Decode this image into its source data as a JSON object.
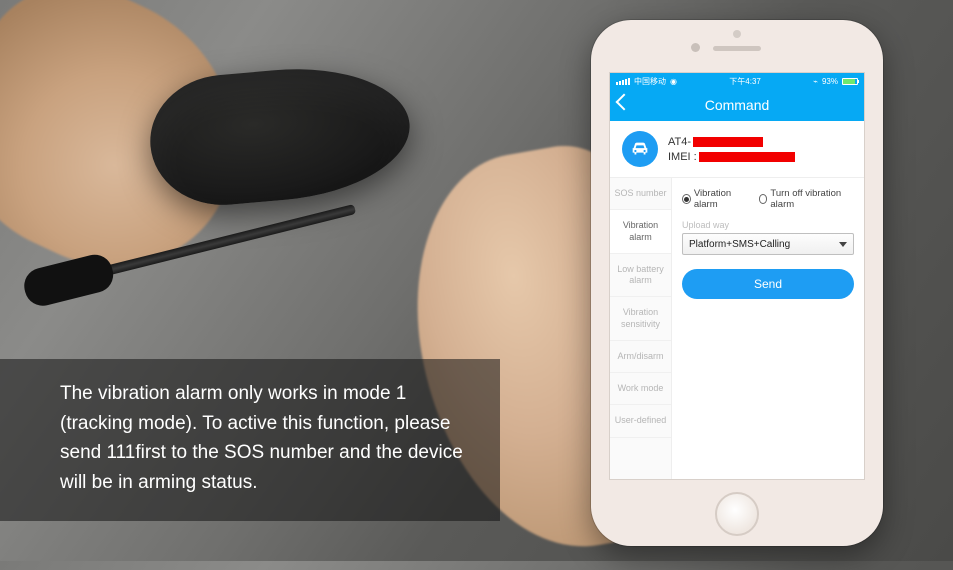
{
  "caption": "The vibration alarm only works in mode 1 (tracking mode). To active this function, please send 111first to the SOS number and the device will be in arming status.",
  "statusbar": {
    "carrier": "中国移动",
    "time": "下午4:37",
    "battery_pct": "93%"
  },
  "navbar": {
    "title": "Command"
  },
  "device": {
    "name_prefix": "AT4-",
    "imei_label": "IMEI :"
  },
  "tabs": {
    "sos": "SOS number",
    "vibration": "Vibration alarm",
    "low_batt": "Low battery alarm",
    "sensitivity": "Vibration sensitivity",
    "arm": "Arm/disarm",
    "work": "Work mode",
    "user": "User-defined"
  },
  "panel": {
    "radio_on": "Vibration alarm",
    "radio_off": "Turn off vibration alarm",
    "upload_label": "Upload way",
    "upload_value": "Platform+SMS+Calling",
    "send": "Send"
  }
}
